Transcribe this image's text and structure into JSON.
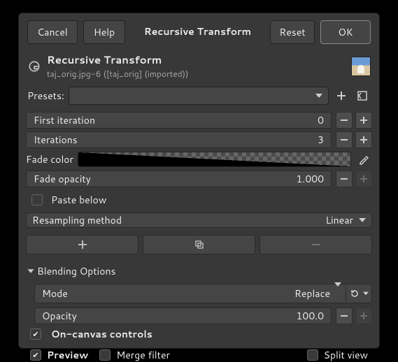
{
  "buttons": {
    "cancel": "Cancel",
    "help": "Help",
    "title": "Recursive Transform",
    "reset": "Reset",
    "ok": "OK"
  },
  "header": {
    "title": "Recursive Transform",
    "subtitle": "taj_orig.jpg-6 ([taj_orig] (imported))"
  },
  "presets": {
    "label": "Presets:"
  },
  "firstIteration": {
    "label": "First iteration",
    "value": "0"
  },
  "iterations": {
    "label": "Iterations",
    "value": "3"
  },
  "fadeColor": {
    "label": "Fade color"
  },
  "fadeOpacity": {
    "label": "Fade opacity",
    "value": "1.000"
  },
  "pasteBelow": {
    "label": "Paste below"
  },
  "resampling": {
    "label": "Resampling method",
    "value": "Linear"
  },
  "blending": {
    "header": "Blending Options",
    "mode": {
      "label": "Mode",
      "value": "Replace"
    },
    "opacity": {
      "label": "Opacity",
      "value": "100.0"
    }
  },
  "onCanvas": {
    "label": "On-canvas controls"
  },
  "preview": {
    "label": "Preview"
  },
  "mergeFilter": {
    "label": "Merge filter"
  },
  "splitView": {
    "label": "Split view"
  }
}
